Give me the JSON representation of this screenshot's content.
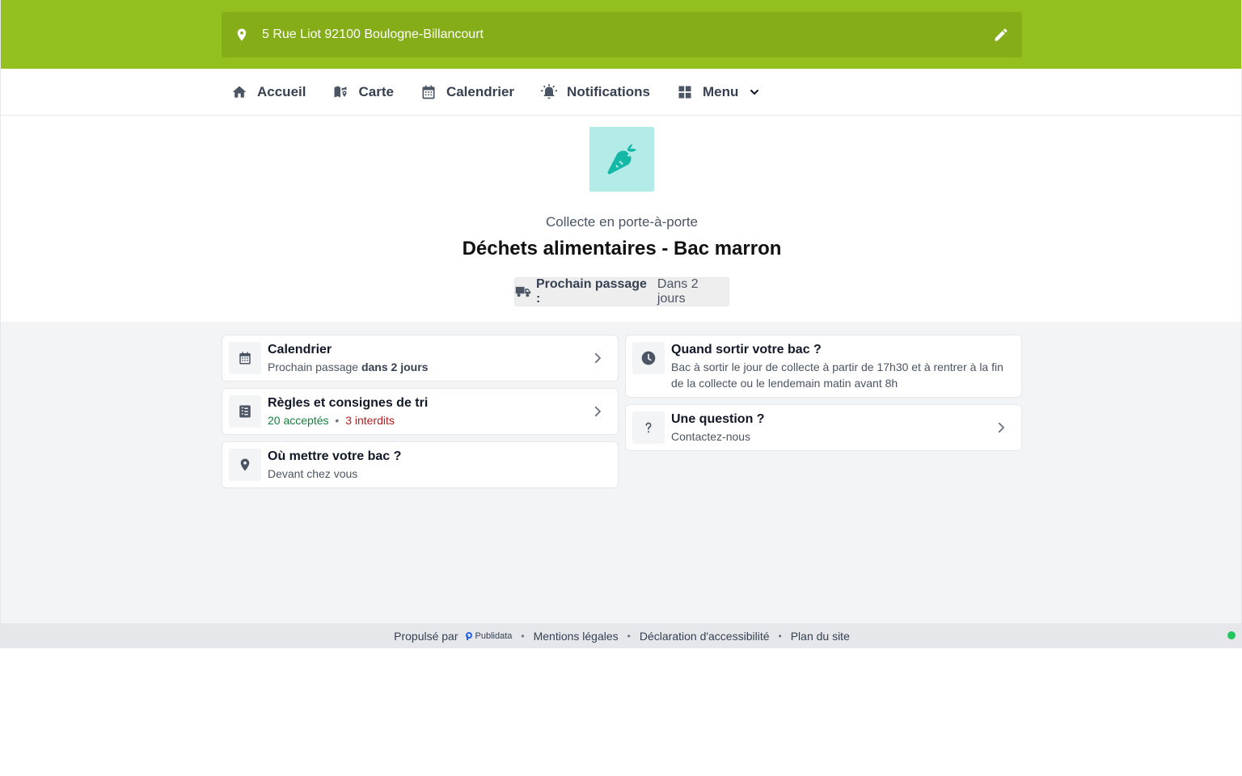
{
  "address": {
    "text": "5 Rue Liot 92100 Boulogne-Billancourt"
  },
  "nav": {
    "items": [
      {
        "label": "Accueil",
        "icon": "home-icon"
      },
      {
        "label": "Carte",
        "icon": "map-icon"
      },
      {
        "label": "Calendrier",
        "icon": "calendar-icon"
      },
      {
        "label": "Notifications",
        "icon": "alarm-bell-icon"
      },
      {
        "label": "Menu",
        "icon": "grid-icon"
      }
    ]
  },
  "hero": {
    "icon": "carrot-icon",
    "subtitle": "Collecte en porte-à-porte",
    "title": "Déchets alimentaires - Bac marron",
    "next_label": "Prochain passage :",
    "next_value": "Dans 2 jours"
  },
  "cards": {
    "calendar": {
      "title": "Calendrier",
      "sub_prefix": "Prochain passage",
      "sub_bold": "dans 2 jours",
      "icon": "calendar-icon"
    },
    "rules": {
      "title": "Règles et consignes de tri",
      "accepted_count": "20",
      "accepted_label": "acceptés",
      "sep": "•",
      "forbidden_count": "3",
      "forbidden_label": "interdits",
      "icon": "checklist-icon"
    },
    "where": {
      "title": "Où mettre votre bac ?",
      "sub": "Devant chez vous",
      "icon": "location-pin-icon"
    },
    "when": {
      "title": "Quand sortir votre bac ?",
      "sub": "Bac à sortir le jour de collecte à partir de 17h30 et à rentrer à la fin de la collecte ou le lendemain matin avant 8h",
      "icon": "clock-icon"
    },
    "question": {
      "title": "Une question ?",
      "sub": "Contactez-nous",
      "icon": "question-mark-icon"
    }
  },
  "footer": {
    "powered_by": "Propulsé par",
    "brand": "Publidata",
    "sep": "•",
    "links": [
      "Mentions légales",
      "Déclaration d'accessibilité",
      "Plan du site"
    ]
  },
  "colors": {
    "header_green": "#93c01f",
    "address_bar": "#84ad18",
    "hero_icon_bg": "#b2ebe8",
    "hero_icon_fg": "#14b8a6",
    "accepted": "#15803d",
    "forbidden": "#b91c1c",
    "status_online": "#22c55e"
  }
}
